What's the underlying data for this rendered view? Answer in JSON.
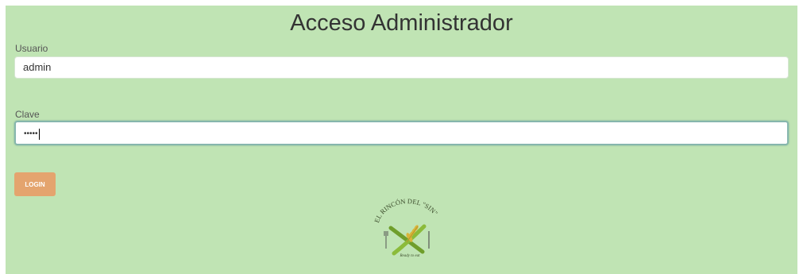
{
  "page": {
    "title": "Acceso Administrador"
  },
  "form": {
    "user_label": "Usuario",
    "user_value": "admin",
    "password_label": "Clave",
    "password_value": "•••••",
    "login_button": "LOGIN"
  },
  "logo": {
    "name": "EL RINCÓN DEL \"SIN\"",
    "tagline": "Ready to eat",
    "icon": "wheat-cross-cutlery-logo"
  },
  "colors": {
    "panel_background": "#c0e4b4",
    "login_button": "#e4a46e",
    "focus_border": "#86b6ad"
  }
}
